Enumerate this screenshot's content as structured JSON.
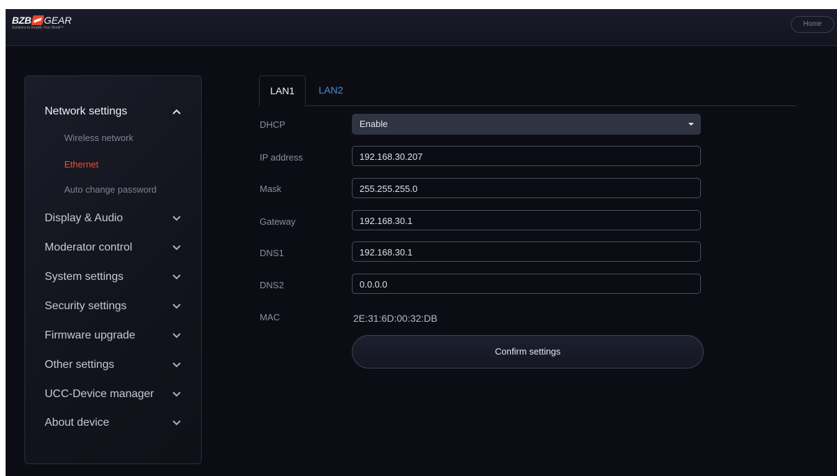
{
  "brand": {
    "name_part1": "BZB",
    "name_part2": "GEAR",
    "tagline": "Solutions to Amplify Your World™"
  },
  "header": {
    "home_label": "Home"
  },
  "sidebar": {
    "items": [
      {
        "label": "Network settings",
        "expanded": true,
        "children": [
          {
            "label": "Wireless network",
            "active": false
          },
          {
            "label": "Ethernet",
            "active": true
          },
          {
            "label": "Auto change password",
            "active": false
          }
        ]
      },
      {
        "label": "Display & Audio",
        "expanded": false
      },
      {
        "label": "Moderator control",
        "expanded": false
      },
      {
        "label": "System settings",
        "expanded": false
      },
      {
        "label": "Security settings",
        "expanded": false
      },
      {
        "label": "Firmware upgrade",
        "expanded": false
      },
      {
        "label": "Other settings",
        "expanded": false
      },
      {
        "label": "UCC-Device manager",
        "expanded": false
      },
      {
        "label": "About device",
        "expanded": false
      }
    ]
  },
  "tabs": [
    {
      "label": "LAN1",
      "active": true
    },
    {
      "label": "LAN2",
      "active": false
    }
  ],
  "form": {
    "dhcp": {
      "label": "DHCP",
      "value": "Enable"
    },
    "ip": {
      "label": "IP address",
      "value": "192.168.30.207"
    },
    "mask": {
      "label": "Mask",
      "value": "255.255.255.0"
    },
    "gateway": {
      "label": "Gateway",
      "value": "192.168.30.1"
    },
    "dns1": {
      "label": "DNS1",
      "value": "192.168.30.1"
    },
    "dns2": {
      "label": "DNS2",
      "value": "0.0.0.0"
    },
    "mac": {
      "label": "MAC",
      "value": "2E:31:6D:00:32:DB"
    },
    "confirm_label": "Confirm settings"
  },
  "colors": {
    "accent": "#f0522b",
    "link": "#4c8ed9",
    "background": "#0c0d14"
  }
}
